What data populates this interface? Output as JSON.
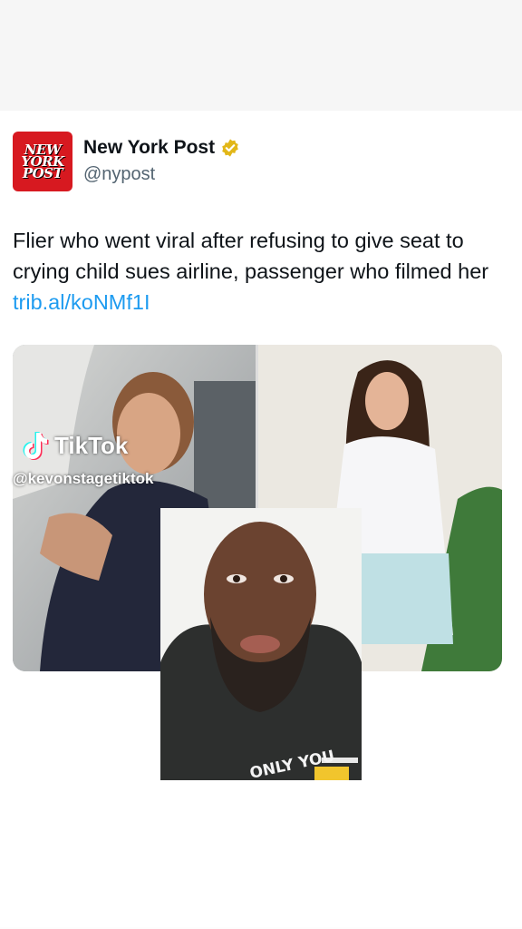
{
  "post": {
    "logo_lines": [
      "NEW",
      "YORK",
      "POST"
    ],
    "account_name": "New York Post",
    "handle": "@nypost",
    "text": "Flier who went viral after refusing to give seat to crying child sues airline, passenger who filmed her",
    "link": "trib.al/koNMf1I"
  },
  "overlay": {
    "tiktok_label": "TikTok",
    "tiktok_handle": "@kevonstagetiktok",
    "shirt_text": "ONLY YOU"
  },
  "colors": {
    "logo_red": "#d71920",
    "verified_gold": "#e2b719",
    "link_blue": "#1d9bf0"
  },
  "icons": [
    "verified-badge-icon",
    "tiktok-note-icon"
  ]
}
